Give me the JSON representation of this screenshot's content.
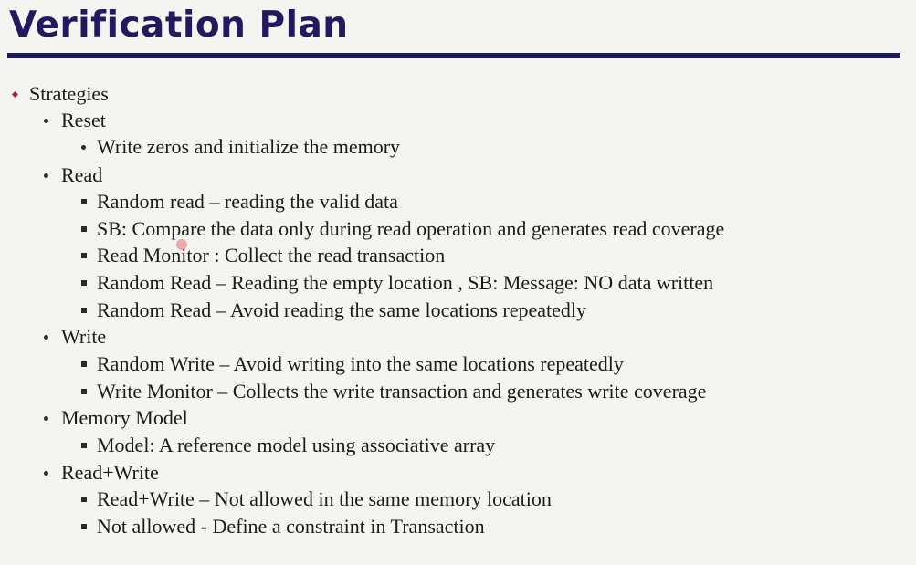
{
  "slide": {
    "title": "Verification Plan"
  },
  "outline": [
    {
      "level": 1,
      "bullet": "diamond",
      "text": "Strategies"
    },
    {
      "level": 2,
      "bullet": "dot",
      "text": "Reset"
    },
    {
      "level": 3,
      "bullet": "dot",
      "text": "Write zeros and initialize the memory"
    },
    {
      "level": 2,
      "bullet": "dot",
      "text": "Read"
    },
    {
      "level": 3,
      "bullet": "square",
      "text": "Random read – reading the valid data"
    },
    {
      "level": 3,
      "bullet": "square",
      "text": "SB: Compare the data only during read operation and generates read coverage"
    },
    {
      "level": 3,
      "bullet": "square",
      "text": "Read Monitor : Collect the read transaction"
    },
    {
      "level": 3,
      "bullet": "square",
      "text": "Random Read – Reading the empty location , SB: Message: NO data written"
    },
    {
      "level": 3,
      "bullet": "square",
      "text": "Random Read – Avoid reading the same locations repeatedly"
    },
    {
      "level": 2,
      "bullet": "dot",
      "text": "Write"
    },
    {
      "level": 3,
      "bullet": "square",
      "text": "Random Write – Avoid writing into the same locations repeatedly"
    },
    {
      "level": 3,
      "bullet": "square",
      "text": "Write Monitor – Collects the write transaction and generates write coverage"
    },
    {
      "level": 2,
      "bullet": "dot",
      "text": "Memory Model"
    },
    {
      "level": 3,
      "bullet": "square",
      "text": "Model: A  reference model using associative array"
    },
    {
      "level": 2,
      "bullet": "dot",
      "text": "Read+Write"
    },
    {
      "level": 3,
      "bullet": "square",
      "text": "Read+Write – Not allowed in the same memory location"
    },
    {
      "level": 3,
      "bullet": "square",
      "text": "Not allowed - Define a constraint in Transaction"
    }
  ]
}
